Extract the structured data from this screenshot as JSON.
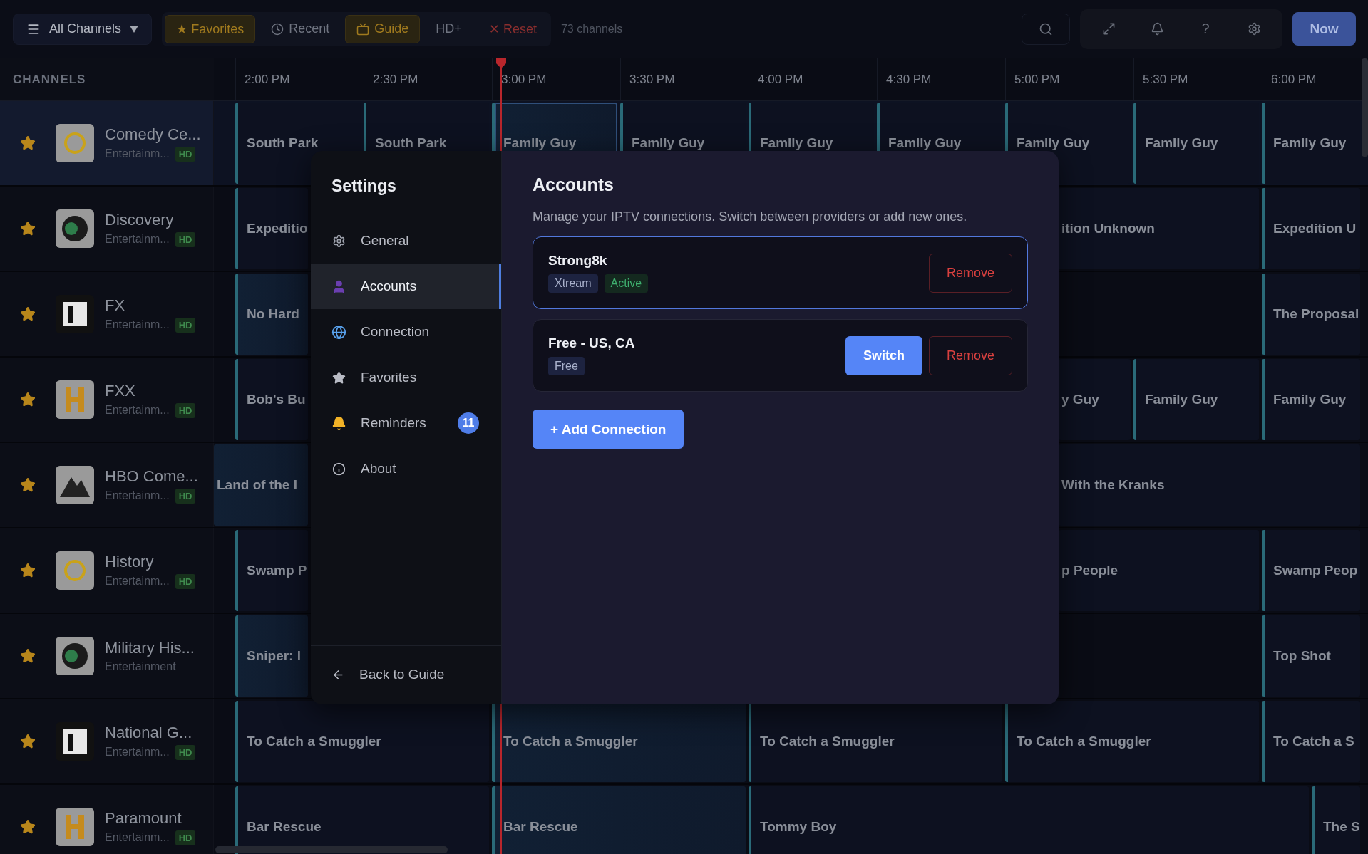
{
  "top_bar": {
    "menu_label": "All Channels",
    "filters": [
      {
        "label": "★ Favorites",
        "kind": "plain",
        "active": true
      },
      {
        "label": "Recent",
        "kind": "clock",
        "active": false
      },
      {
        "label": "Guide",
        "kind": "tv",
        "active": true
      },
      {
        "label": "HD+",
        "kind": "plain",
        "active": false
      },
      {
        "label": "✕ Reset",
        "kind": "reset",
        "active": false
      }
    ],
    "channel_count": "73 channels",
    "help_label": "?",
    "now_button": "Now"
  },
  "guide": {
    "header": "CHANNELS",
    "times": [
      "2:00 PM",
      "2:30 PM",
      "3:00 PM",
      "3:30 PM",
      "4:00 PM",
      "4:30 PM",
      "5:00 PM",
      "5:30 PM",
      "6:00 PM"
    ],
    "channels": [
      {
        "name": "Comedy Ce...",
        "category": "Entertainm...",
        "badge": "HD",
        "favorite": true,
        "selected": true,
        "programs": [
          {
            "title": "South Park",
            "current": false
          },
          {
            "title": "South Park",
            "current": false
          },
          {
            "title": "Family Guy",
            "current": true
          },
          {
            "title": "Family Guy",
            "current": false
          },
          {
            "title": "Family Guy",
            "current": false
          },
          {
            "title": "Family Guy",
            "current": false
          },
          {
            "title": "Family Guy",
            "current": false
          },
          {
            "title": "Family Guy",
            "current": false
          },
          {
            "title": "Family Guy",
            "current": false
          }
        ]
      },
      {
        "name": "Discovery",
        "category": "Entertainm...",
        "badge": "HD",
        "favorite": true,
        "selected": false,
        "programs": [
          {
            "title": "Expeditio",
            "current": false
          },
          {
            "title": "ition Unknown",
            "current": false
          },
          {
            "title": "Expedition U",
            "current": false
          }
        ]
      },
      {
        "name": "FX",
        "category": "Entertainm...",
        "badge": "HD",
        "favorite": true,
        "selected": false,
        "programs": [
          {
            "title": "No Hard",
            "current": true
          },
          {
            "title": "The Proposal",
            "current": false
          }
        ]
      },
      {
        "name": "FXX",
        "category": "Entertainm...",
        "badge": "HD",
        "favorite": true,
        "selected": false,
        "programs": [
          {
            "title": "Bob's Bu",
            "current": false
          },
          {
            "title": "y Guy",
            "current": false
          },
          {
            "title": "Family Guy",
            "current": false
          },
          {
            "title": "Family Guy",
            "current": false
          }
        ]
      },
      {
        "name": "HBO Come...",
        "category": "Entertainm...",
        "badge": "HD",
        "favorite": true,
        "selected": false,
        "programs": [
          {
            "title": "Land of the I",
            "current": true
          },
          {
            "title": "With the Kranks",
            "current": false
          }
        ]
      },
      {
        "name": "History",
        "category": "Entertainm...",
        "badge": "HD",
        "favorite": true,
        "selected": false,
        "programs": [
          {
            "title": "Swamp P",
            "current": false
          },
          {
            "title": "p People",
            "current": false
          },
          {
            "title": "Swamp Peop",
            "current": false
          }
        ]
      },
      {
        "name": "Military His...",
        "category": "Entertainment",
        "favorite": true,
        "selected": false,
        "programs": [
          {
            "title": "Sniper: I",
            "current": true
          },
          {
            "title": "Top Shot",
            "current": false
          }
        ]
      },
      {
        "name": "National G...",
        "category": "Entertainm...",
        "badge": "HD",
        "favorite": true,
        "selected": false,
        "programs": [
          {
            "title": "To Catch a Smuggler",
            "current": false
          },
          {
            "title": "To Catch a Smuggler",
            "current": true
          },
          {
            "title": "To Catch a Smuggler",
            "current": false
          },
          {
            "title": "To Catch a Smuggler",
            "current": false
          },
          {
            "title": "To Catch a S",
            "current": false
          }
        ]
      },
      {
        "name": "Paramount",
        "category": "Entertainm...",
        "badge": "HD",
        "favorite": true,
        "selected": false,
        "programs": [
          {
            "title": "Bar Rescue",
            "current": false
          },
          {
            "title": "Bar Rescue",
            "current": true
          },
          {
            "title": "Tommy Boy",
            "current": false
          },
          {
            "title": "The S",
            "current": false
          }
        ]
      }
    ]
  },
  "settings": {
    "title": "Settings",
    "nav": [
      {
        "label": "General",
        "kind": "gear",
        "selected": false
      },
      {
        "label": "Accounts",
        "kind": "person",
        "selected": true
      },
      {
        "label": "Connection",
        "kind": "globe",
        "selected": false
      },
      {
        "label": "Favorites",
        "kind": "star",
        "selected": false
      },
      {
        "label": "Reminders",
        "kind": "bell",
        "selected": false,
        "badge": "11"
      },
      {
        "label": "About",
        "kind": "info",
        "selected": false
      }
    ],
    "back_label": "Back to Guide",
    "heading": "Accounts",
    "description": "Manage your IPTV connections. Switch between providers or add new ones.",
    "accounts": [
      {
        "name": "Strong8k",
        "active": true,
        "tags": [
          {
            "label": "Xtream",
            "kind": "type"
          },
          {
            "label": "Active",
            "kind": "status"
          }
        ],
        "actions": [
          {
            "label": "Remove",
            "kind": "danger"
          }
        ]
      },
      {
        "name": "Free - US, CA",
        "active": false,
        "tags": [
          {
            "label": "Free",
            "kind": "type"
          }
        ],
        "actions": [
          {
            "label": "Switch",
            "kind": "primary"
          },
          {
            "label": "Remove",
            "kind": "danger"
          }
        ]
      }
    ],
    "add_button": "+ Add Connection"
  }
}
